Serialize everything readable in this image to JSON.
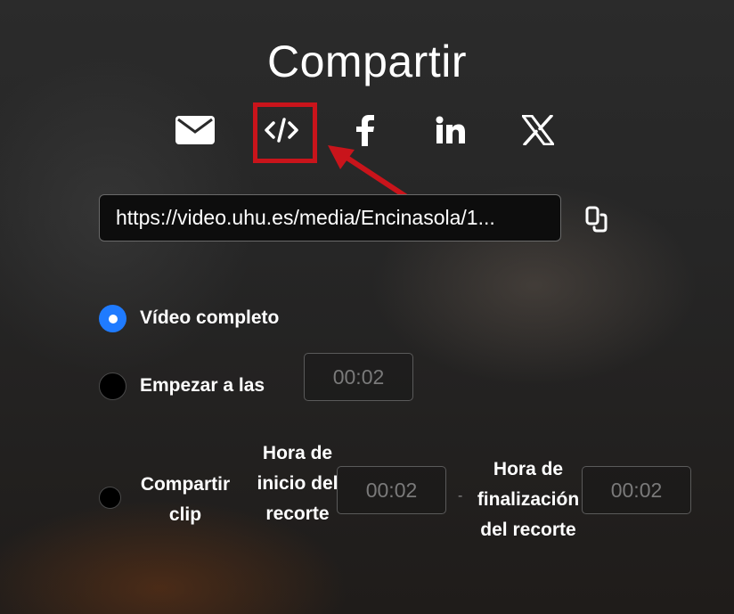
{
  "dialog": {
    "title": "Compartir"
  },
  "share_icons": [
    {
      "name": "email-icon"
    },
    {
      "name": "embed-code-icon"
    },
    {
      "name": "facebook-icon"
    },
    {
      "name": "linkedin-icon"
    },
    {
      "name": "x-icon"
    }
  ],
  "annotation": {
    "highlight_color": "#c9141b"
  },
  "link": {
    "url": "https://video.uhu.es/media/Encinasola/1..."
  },
  "options": {
    "full_video_label": "Vídeo completo",
    "start_at_label": "Empezar a las",
    "start_at_value": "00:02",
    "clip_label": "Compartir clip",
    "clip_start_label": "Hora de inicio del recorte",
    "clip_start_value": "00:02",
    "clip_separator": "-",
    "clip_end_label": "Hora de finalización del recorte",
    "clip_end_value": "00:02",
    "selected": "full_video"
  },
  "colors": {
    "radio_selected": "#1f7bff"
  }
}
